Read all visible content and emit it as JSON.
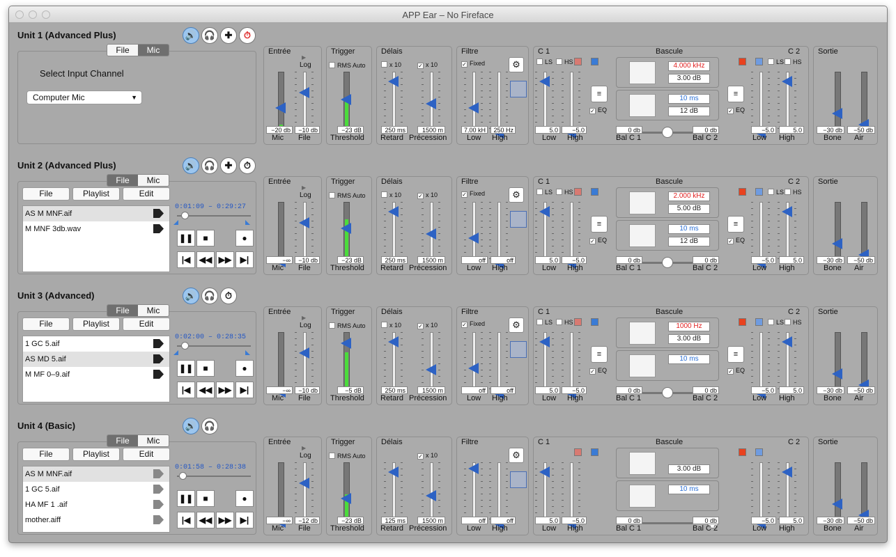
{
  "window_title": "APP Ear – No Fireface",
  "units": [
    {
      "name": "Unit 1 (Advanced Plus)",
      "mode": "mic",
      "icons": [
        "speaker-icon",
        "headphones-icon",
        "plus-icon",
        "timer-icon"
      ],
      "seg": [
        "File",
        "Mic"
      ],
      "select_label": "Select Input Channel",
      "input_channel": "Computer Mic",
      "entree": {
        "title": "Entrée",
        "log": "Log",
        "mic_val": "−20 db",
        "file_val": "−10 db",
        "mic": "Mic",
        "file": "File",
        "meter": 0.1
      },
      "trigger": {
        "title": "Trigger",
        "rms": "RMS Auto",
        "val": "−23 dB",
        "label": "Threshold",
        "meter": 0.55
      },
      "delais": {
        "title": "Délais",
        "x10a": "x 10",
        "x10b": "x 10",
        "retard_val": "250 ms",
        "prec_val": "1500 m",
        "retard": "Retard",
        "prec": "Précession",
        "x10a_checked": false,
        "x10b_checked": true
      },
      "filtre": {
        "title": "Filtre",
        "fixed": "Fixed",
        "low_val": "7.00 kH",
        "high_val": "250 Hz",
        "low": "Low",
        "high": "High",
        "fixed_checked": true
      },
      "c1": {
        "title": "C 1",
        "ls": "LS",
        "hs": "HS",
        "low_val": "5.0",
        "high_val": "−5.0",
        "low": "Low",
        "high": "High",
        "eq": "EQ"
      },
      "bascule": {
        "title": "Bascule",
        "freq": "4.000 kHz",
        "gain": "3.00 dB",
        "time": "10 ms",
        "time_db": "12 dB",
        "balc1_val": "0 db",
        "balc2_val": "0 db",
        "balc1": "Bal C 1",
        "balc2": "Bal C 2"
      },
      "c2": {
        "title": "C 2",
        "ls": "LS",
        "hs": "HS",
        "low_val": "−5.0",
        "high_val": "5.0",
        "low": "Low",
        "high": "High",
        "eq": "EQ"
      },
      "sortie": {
        "title": "Sortie",
        "bone_val": "−30 db",
        "air_val": "−50 db",
        "bone": "Bone",
        "air": "Air"
      }
    },
    {
      "name": "Unit 2 (Advanced Plus)",
      "mode": "file",
      "icons": [
        "speaker-icon",
        "headphones-icon",
        "plus-icon",
        "timer-icon"
      ],
      "seg": [
        "File",
        "Mic"
      ],
      "buttons": [
        "File",
        "Playlist",
        "Edit"
      ],
      "time": "0:01:09 – 0:29:27",
      "playlist": [
        "AS M MNF.aif",
        "M MNF 3db.wav"
      ],
      "entree": {
        "title": "Entrée",
        "log": "Log",
        "mic_val": "−∞",
        "file_val": "−10 db",
        "mic": "Mic",
        "file": "File",
        "meter": 0.02
      },
      "trigger": {
        "title": "Trigger",
        "rms": "RMS Auto",
        "val": "−23 dB",
        "label": "Threshold",
        "meter": 0.7
      },
      "delais": {
        "title": "Délais",
        "x10a": "x 10",
        "x10b": "x 10",
        "retard_val": "250 ms",
        "prec_val": "1500 m",
        "retard": "Retard",
        "prec": "Précession",
        "x10a_checked": false,
        "x10b_checked": true
      },
      "filtre": {
        "title": "Filtre",
        "fixed": "Fixed",
        "low_val": "off",
        "high_val": "off",
        "low": "Low",
        "high": "High",
        "fixed_checked": true
      },
      "c1": {
        "title": "C 1",
        "ls": "LS",
        "hs": "HS",
        "low_val": "5.0",
        "high_val": "−5.0",
        "low": "Low",
        "high": "High",
        "eq": "EQ"
      },
      "bascule": {
        "title": "Bascule",
        "freq": "2.000 kHz",
        "gain": "5.00 dB",
        "time": "10 ms",
        "time_db": "12 dB",
        "balc1_val": "0 db",
        "balc2_val": "0 db",
        "balc1": "Bal C 1",
        "balc2": "Bal C 2"
      },
      "c2": {
        "title": "C 2",
        "ls": "LS",
        "hs": "HS",
        "low_val": "−5.0",
        "high_val": "5.0",
        "low": "Low",
        "high": "High",
        "eq": "EQ"
      },
      "sortie": {
        "title": "Sortie",
        "bone_val": "−30 db",
        "air_val": "−50 db",
        "bone": "Bone",
        "air": "Air"
      }
    },
    {
      "name": "Unit 3 (Advanced)",
      "mode": "file",
      "icons": [
        "speaker-icon",
        "headphones-icon",
        "timer-icon"
      ],
      "seg": [
        "File",
        "Mic"
      ],
      "buttons": [
        "File",
        "Playlist",
        "Edit"
      ],
      "time": "0:02:00 – 0:28:35",
      "playlist": [
        "1 GC 5.aif",
        "AS MD 5.aif",
        "M MF 0–9.aif"
      ],
      "entree": {
        "title": "Entrée",
        "log": "Log",
        "mic_val": "−∞",
        "file_val": "−10 db",
        "mic": "Mic",
        "file": "File",
        "meter": 0.02
      },
      "trigger": {
        "title": "Trigger",
        "rms": "RMS Auto",
        "val": "−5 dB",
        "label": "Threshold",
        "meter": 0.65
      },
      "delais": {
        "title": "Délais",
        "x10a": "x 10",
        "x10b": "x 10",
        "retard_val": "250 ms",
        "prec_val": "1500 m",
        "retard": "Retard",
        "prec": "Précession",
        "x10a_checked": false,
        "x10b_checked": true
      },
      "filtre": {
        "title": "Filtre",
        "fixed": "Fixed",
        "low_val": "off",
        "high_val": "off",
        "low": "Low",
        "high": "High",
        "fixed_checked": true
      },
      "c1": {
        "title": "C 1",
        "ls": "LS",
        "hs": "HS",
        "low_val": "5.0",
        "high_val": "−5.0",
        "low": "Low",
        "high": "High",
        "eq": "EQ"
      },
      "bascule": {
        "title": "Bascule",
        "freq": "1000 Hz",
        "gain": "3.00 dB",
        "time": "10 ms",
        "time_db": "",
        "balc1_val": "0 db",
        "balc2_val": "0 db",
        "balc1": "Bal C 1",
        "balc2": "Bal C 2"
      },
      "c2": {
        "title": "C 2",
        "ls": "LS",
        "hs": "HS",
        "low_val": "−5.0",
        "high_val": "5.0",
        "low": "Low",
        "high": "High",
        "eq": "EQ"
      },
      "sortie": {
        "title": "Sortie",
        "bone_val": "−30 db",
        "air_val": "−50 db",
        "bone": "Bone",
        "air": "Air"
      }
    },
    {
      "name": "Unit 4 (Basic)",
      "mode": "file",
      "icons": [
        "speaker-icon",
        "headphones-icon"
      ],
      "seg": [
        "File",
        "Mic"
      ],
      "buttons": [
        "File",
        "Playlist",
        "Edit"
      ],
      "time": "0:01:58 – 0:28:38",
      "playlist": [
        "AS M MNF.aif",
        "1 GC 5.aif",
        "HA MF 1 .aif",
        "mother.aiff"
      ],
      "entree": {
        "title": "Entrée",
        "log": "Log",
        "mic_val": "−∞",
        "file_val": "−12 db",
        "mic": "Mic",
        "file": "File",
        "meter": 0.02
      },
      "trigger": {
        "title": "Trigger",
        "rms": "RMS Auto",
        "val": "−23 dB",
        "label": "Threshold",
        "meter": 0.45
      },
      "delais": {
        "title": "Délais",
        "x10a": "",
        "x10b": "x 10",
        "retard_val": "125 ms",
        "prec_val": "1500 m",
        "retard": "Retard",
        "prec": "Précession",
        "x10a_checked": false,
        "x10b_checked": true
      },
      "filtre": {
        "title": "Filtre",
        "fixed": "",
        "low_val": "off",
        "high_val": "off",
        "low": "Low",
        "high": "High",
        "fixed_checked": false
      },
      "c1": {
        "title": "C 1",
        "ls": "",
        "hs": "",
        "low_val": "5.0",
        "high_val": "−5.0",
        "low": "Low",
        "high": "High",
        "eq": ""
      },
      "bascule": {
        "title": "Bascule",
        "freq": "",
        "gain": "3.00 dB",
        "time": "10 ms",
        "time_db": "",
        "balc1_val": "0 db",
        "balc2_val": "0 db",
        "balc1": "Bal C 1",
        "balc2": "Bal C 2"
      },
      "c2": {
        "title": "C 2",
        "ls": "",
        "hs": "",
        "low_val": "−5.0",
        "high_val": "5.0",
        "low": "Low",
        "high": "High",
        "eq": ""
      },
      "sortie": {
        "title": "Sortie",
        "bone_val": "−30 db",
        "air_val": "−50 db",
        "bone": "Bone",
        "air": "Air"
      }
    }
  ],
  "colors": {
    "accent": "#2d62c4",
    "meter_green": "#4bdc3b",
    "red_value": "#e02020",
    "blue_value": "#2a6fd6"
  }
}
